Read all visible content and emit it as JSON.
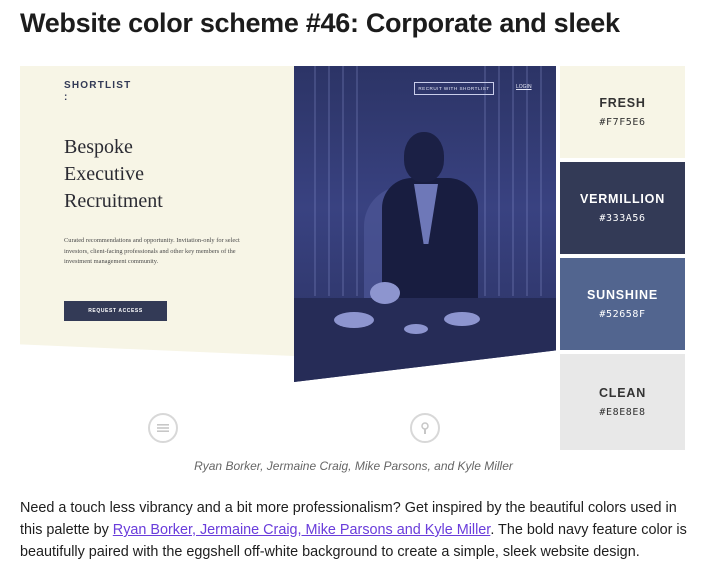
{
  "title": "Website color scheme #46: Corporate and sleek",
  "preview": {
    "brand": "SHORTLIST",
    "brand_colon": ":",
    "headline_lines": [
      "Bespoke",
      "Executive",
      "Recruitment"
    ],
    "blurb": "Curated recommendations and opportunity. Invitation-only for select investors, client-facing professionals and other key members of the investment management community.",
    "cta": "REQUEST ACCESS",
    "nav_button": "RECRUIT WITH SHORTLIST",
    "nav_login": "LOGIN"
  },
  "swatches": [
    {
      "name": "FRESH",
      "hex": "#F7F5E6",
      "bg": "#F7F5E6",
      "fg": "#333333"
    },
    {
      "name": "VERMILLION",
      "hex": "#333A56",
      "bg": "#333A56",
      "fg": "#ffffff"
    },
    {
      "name": "SUNSHINE",
      "hex": "#52658F",
      "bg": "#52658F",
      "fg": "#ffffff"
    },
    {
      "name": "CLEAN",
      "hex": "#E8E8E8",
      "bg": "#E8E8E8",
      "fg": "#333333"
    }
  ],
  "caption": "Ryan Borker, Jermaine Craig, Mike Parsons, and Kyle Miller",
  "body": {
    "before_link": "Need a touch less vibrancy and a bit more professionalism? Get inspired by the beautiful colors used in this palette by ",
    "link": "Ryan Borker, Jermaine Craig, Mike Parsons and Kyle Miller",
    "after_link": ". The bold navy feature color is beautifully paired with the eggshell off-white background to create a simple, sleek website design."
  },
  "icons": {
    "left_circle": "menu-icon",
    "mid_circle": "lock-icon"
  }
}
